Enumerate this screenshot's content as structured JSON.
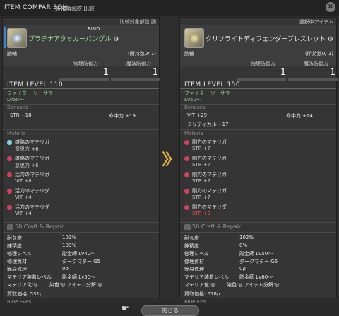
{
  "window": {
    "title": "ITEM COMPARISON",
    "subtitle": "装備詳細を比較",
    "close": "×"
  },
  "arrow_glyph": "〉〉",
  "footer": {
    "close_label": "閉じる",
    "hand": "☛"
  },
  "left": {
    "header": "比較対象部位:腕",
    "bind": "BIND",
    "name": "プラチナアタッカーバングル",
    "hq": "⚙",
    "slot": "腕輪",
    "owned": "(所持数0/ 1)",
    "phys_label": "物理防御力",
    "phys_value": "1",
    "mag_label": "魔法防御力",
    "mag_value": "1",
    "ilvl": "ITEM LEVEL 110",
    "jobs": "ファイター ソーサラー",
    "lv": "Lv50～",
    "bonuses_label": "Bonuses",
    "bonuses": [
      {
        "k": "STR +18",
        "v": "命中力 +19"
      }
    ],
    "materia_label": "Materia",
    "materia": [
      {
        "name": "雄略のマテリガ",
        "val": "意思力 +6",
        "color": "#7fd0e0"
      },
      {
        "name": "雄略のマテリガ",
        "val": "意思力 +6",
        "color": "#d04060"
      },
      {
        "name": "活力のマテリガ",
        "val": "VIT +8",
        "color": "#d04060"
      },
      {
        "name": "活力のマテリダ",
        "val": "VIT +4",
        "color": "#d04060"
      },
      {
        "name": "活力のマテリダ",
        "val": "VIT +4",
        "color": "#d04060"
      }
    ],
    "craft_label": "50 Craft & Repair",
    "rows": [
      {
        "k": "耐久度",
        "v": "102%"
      },
      {
        "k": "錬精度",
        "v": "100%"
      },
      {
        "k": "修理レベル",
        "v": "彫金師 Lv40～"
      },
      {
        "k": "修理資材",
        "v": "ダークマター G5"
      },
      {
        "k": "簡易修理",
        "v": "0ρ"
      },
      {
        "k": "マテリア装着レベル",
        "v": "彫金師 Lv50～"
      },
      {
        "k": "マテリア化:◎",
        "v": "染色:◎   アイテム分解:◎"
      }
    ],
    "sell": "買取価格: 531ρ",
    "maker": "Blue Eyes"
  },
  "right": {
    "header": "選択中アイテム",
    "name": "クリソライトディフェンダーブレスレット",
    "hq": "⚙",
    "slot": "腕輪",
    "owned": "(所持数0/ 1)",
    "phys_label": "物理防御力",
    "phys_value": "1",
    "mag_label": "魔法防御力",
    "mag_value": "1",
    "ilvl": "ITEM LEVEL 150",
    "jobs": "ファイター ソーサラー",
    "lv": "Lv50～",
    "bonuses_label": "Bonuses",
    "bonuses": [
      {
        "k": "VIT +29",
        "v": "命中力 +24"
      },
      {
        "k": "クリティカル +17",
        "v": ""
      }
    ],
    "materia_label": "Materia",
    "materia": [
      {
        "name": "剛力のマテリガ",
        "val": "STR +7",
        "color": "#d04060",
        "red": false
      },
      {
        "name": "剛力のマテリガ",
        "val": "STR +7",
        "color": "#d04060",
        "red": false
      },
      {
        "name": "剛力のマテリガ",
        "val": "STR +7",
        "color": "#d04060",
        "red": false
      },
      {
        "name": "剛力のマテリガ",
        "val": "STR +7",
        "color": "#d04060",
        "red": false
      },
      {
        "name": "剛力のマテリダ",
        "val": "STR +3",
        "color": "#d04060",
        "red": true
      }
    ],
    "craft_label": "50 Craft & Repair",
    "rows": [
      {
        "k": "耐久度",
        "v": "102%"
      },
      {
        "k": "錬精度",
        "v": "0%"
      },
      {
        "k": "修理レベル",
        "v": "彫金師 Lv50～"
      },
      {
        "k": "修理資材",
        "v": "ダークマター G6"
      },
      {
        "k": "簡易修理",
        "v": "0ρ"
      },
      {
        "k": "マテリア装着レベル",
        "v": "彫金師 Lv60～"
      },
      {
        "k": "マテリア化:◎",
        "v": "染色:◎   アイテム分解:◎"
      }
    ],
    "sell": "買取価格: 578ρ",
    "maker": "Blue Eris"
  }
}
